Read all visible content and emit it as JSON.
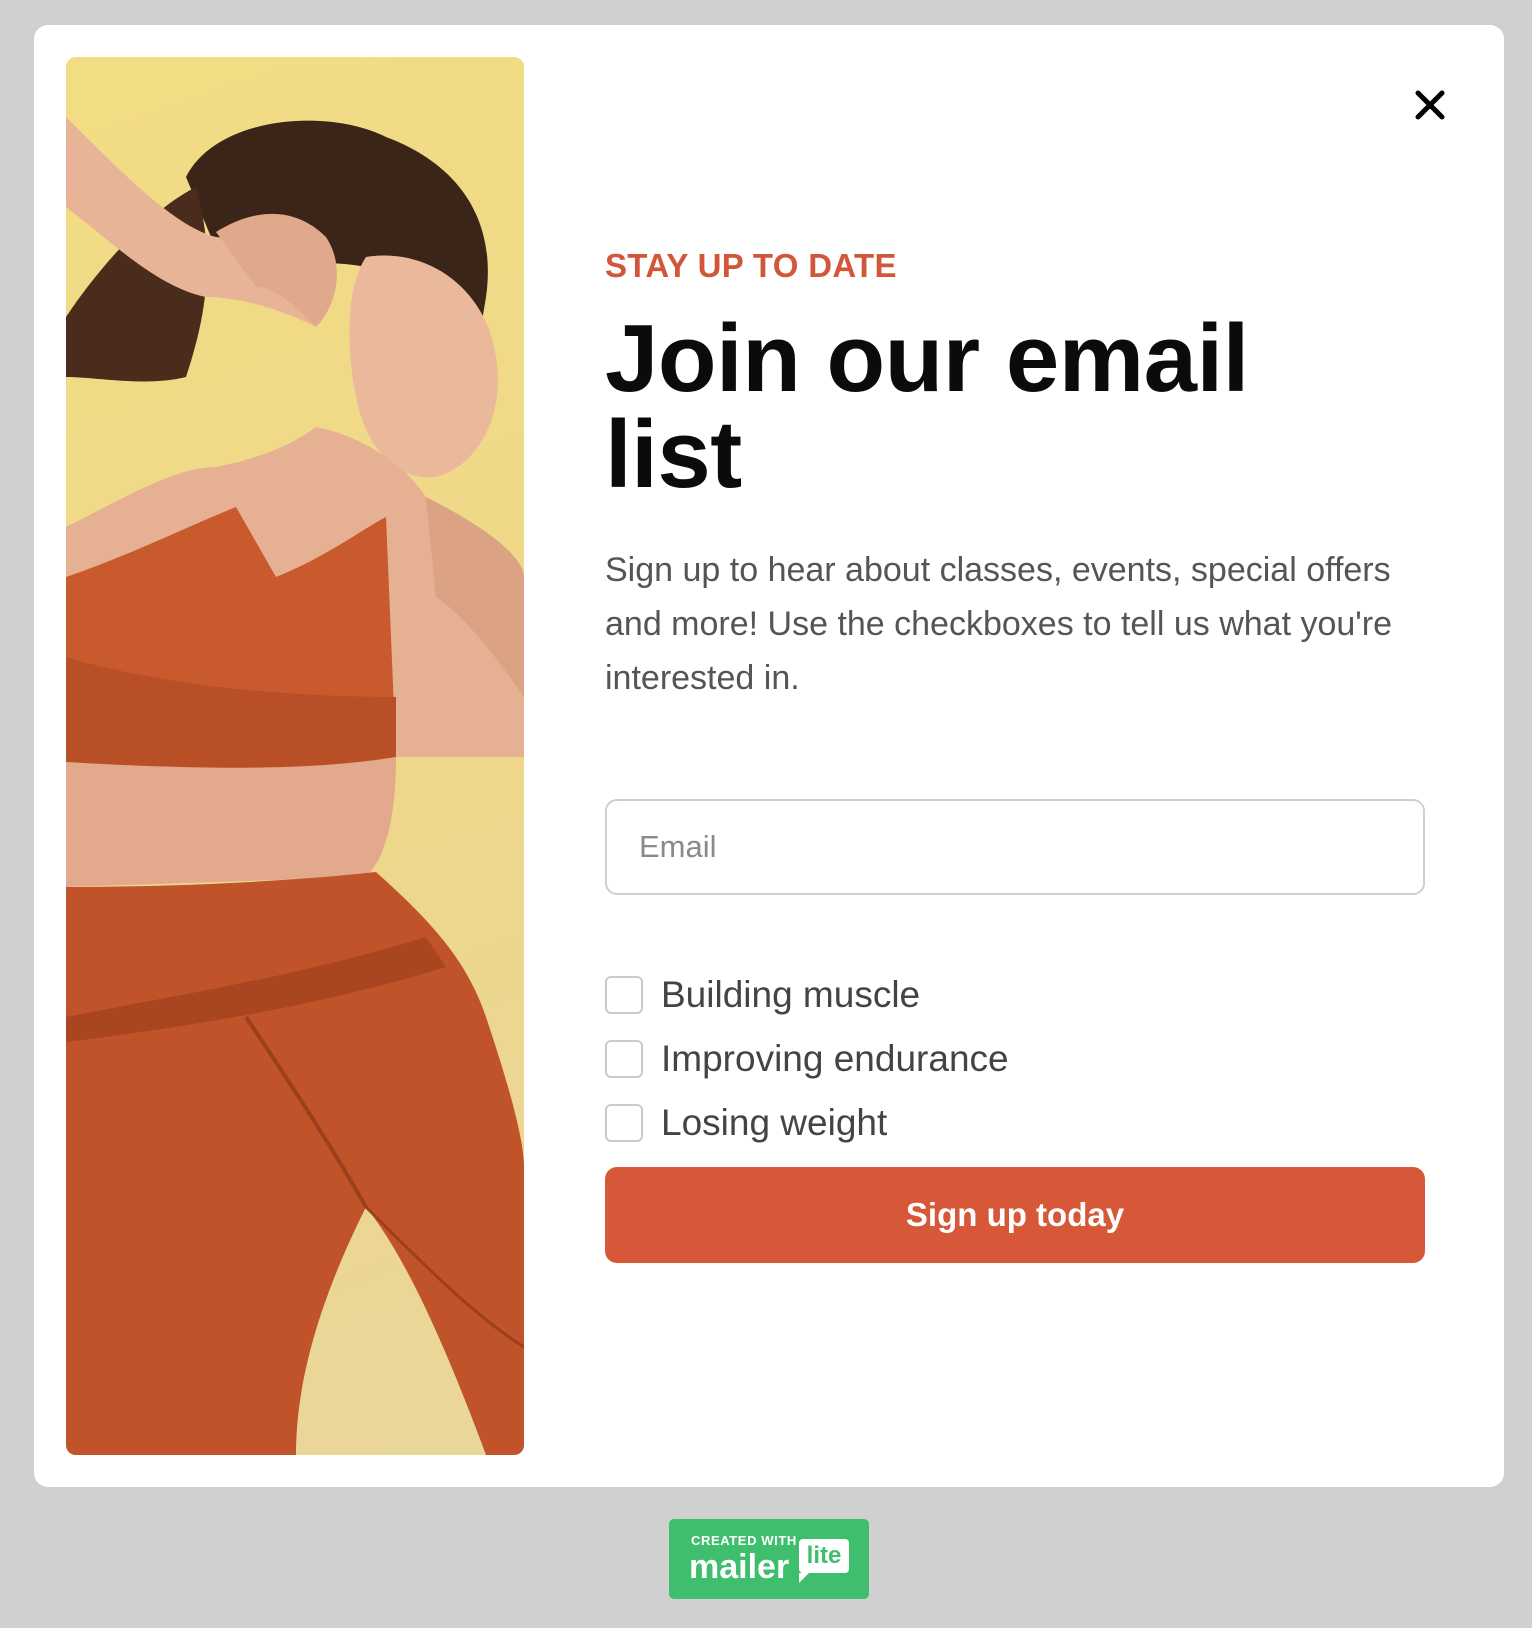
{
  "modal": {
    "eyebrow": "STAY UP TO DATE",
    "heading": "Join our email list",
    "description": "Sign up to hear about classes, events, special offers and more! Use the checkboxes to tell us what you're interested in.",
    "email": {
      "placeholder": "Email",
      "value": ""
    },
    "options": [
      {
        "label": "Building muscle",
        "checked": false
      },
      {
        "label": "Improving endurance",
        "checked": false
      },
      {
        "label": "Losing weight",
        "checked": false
      }
    ],
    "submit_label": "Sign up today",
    "close_icon": "close-icon"
  },
  "badge": {
    "top_text": "CREATED WITH",
    "brand_word": "mailer",
    "brand_tag": "lite"
  },
  "colors": {
    "accent": "#d75839",
    "eyebrow": "#d2573a",
    "page_background": "#d0d0d0",
    "badge_green": "#3fbf6d"
  }
}
